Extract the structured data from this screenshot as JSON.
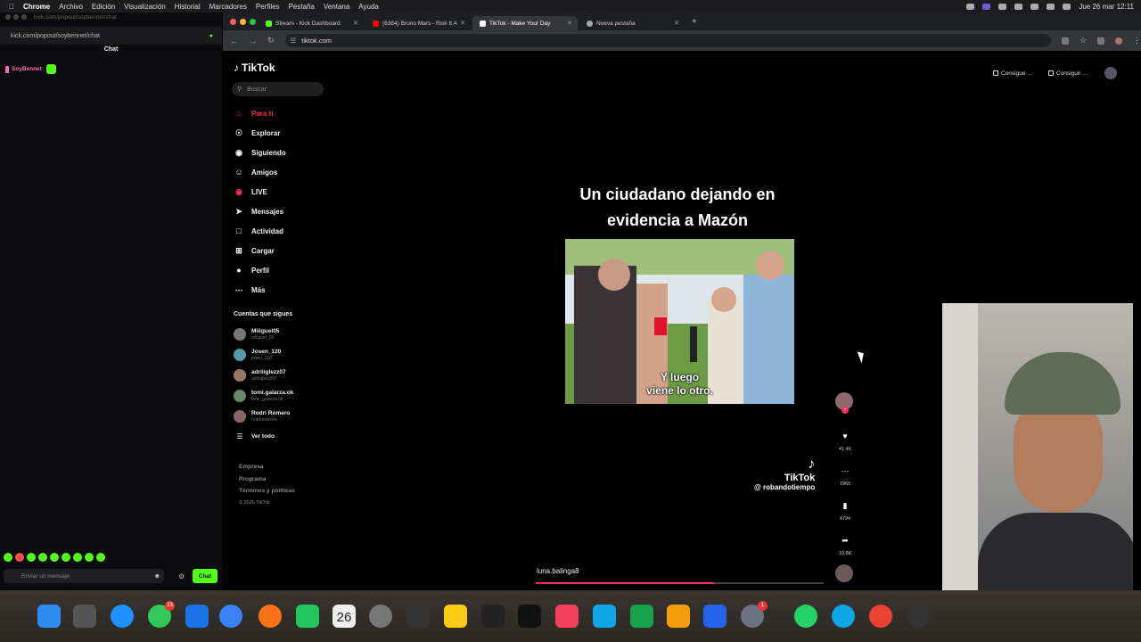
{
  "menubar": {
    "app": "Chrome",
    "items": [
      "Archivo",
      "Edición",
      "Visualización",
      "Historial",
      "Marcadores",
      "Perfiles",
      "Pestaña",
      "Ventana",
      "Ayuda"
    ],
    "clock": "Jue 26 mar 12:11"
  },
  "chat_window": {
    "tab_url_faded": "kick.com/popout/soybennet/chat",
    "url": "kick.com/popout/soybennet/chat",
    "header": "Chat",
    "message_user": "SoyBennet:",
    "input_placeholder": "Enviar un mensaje",
    "send_label": "Chat"
  },
  "browser": {
    "tabs": [
      {
        "label": "Stream - Kick Dashboard",
        "color": "#53fc18"
      },
      {
        "label": "(6384) Bruno Mars - Risk It A",
        "color": "#ff0000"
      },
      {
        "label": "TikTok - Make Your Day",
        "color": "#ffffff"
      },
      {
        "label": "Nueva pestaña",
        "color": "#aaaaaa"
      }
    ],
    "url": "tiktok.com"
  },
  "tiktok": {
    "logo": "TikTok",
    "search_placeholder": "Buscar",
    "nav": [
      {
        "label": "Para ti",
        "icon": "home-icon",
        "active": true
      },
      {
        "label": "Explorar",
        "icon": "compass-icon"
      },
      {
        "label": "Siguiendo",
        "icon": "following-icon"
      },
      {
        "label": "Amigos",
        "icon": "friends-icon"
      },
      {
        "label": "LIVE",
        "icon": "live-icon"
      },
      {
        "label": "Mensajes",
        "icon": "messages-icon"
      },
      {
        "label": "Actividad",
        "icon": "activity-icon"
      },
      {
        "label": "Cargar",
        "icon": "upload-icon"
      },
      {
        "label": "Perfil",
        "icon": "profile-icon"
      },
      {
        "label": "Más",
        "icon": "more-icon"
      }
    ],
    "following_title": "Cuentas que sigues",
    "following": [
      {
        "name": "Miiiguel05",
        "handle": "miiiguel_05"
      },
      {
        "name": "Josen_120",
        "handle": "josen_120"
      },
      {
        "name": "adriiiglezz07",
        "handle": "adriiiglezz07"
      },
      {
        "name": "tomi.galarza.ok",
        "handle": "tomi_galarza.ok"
      },
      {
        "name": "Rodri Romero",
        "handle": "rodriromeroo"
      }
    ],
    "see_all": "Ver todo",
    "footer": [
      "Empresa",
      "Programa",
      "Términos y políticas"
    ],
    "copyright": "© 2026 TikTok",
    "top_buttons": [
      "Consigue ...",
      "Consiguir ..."
    ],
    "video": {
      "title_line1": "Un ciudadano dejando en",
      "title_line2": "evidencia a Mazón",
      "caption_line1": "Y luego",
      "caption_line2": "viene lo otro.",
      "watermark": "TikTok",
      "watermark_handle": "@ robandotiempo",
      "username": "luna.balinga8",
      "progress": 0.62
    },
    "actions": [
      {
        "icon": "heart-icon",
        "count": "41.4K"
      },
      {
        "icon": "comment-icon",
        "count": "1965"
      },
      {
        "icon": "bookmark-icon",
        "count": "4794"
      },
      {
        "icon": "share-icon",
        "count": "10.8K"
      }
    ]
  },
  "dock": {
    "day": "26",
    "badge_messages": "23",
    "badge_settings": "1"
  }
}
